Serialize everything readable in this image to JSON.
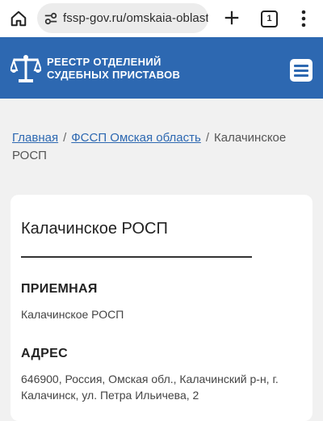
{
  "browser": {
    "url": "fssp-gov.ru/omskaia-oblast/ka",
    "tab_count": "1"
  },
  "header": {
    "title_line1": "РЕЕСТР ОТДЕЛЕНИЙ",
    "title_line2": "СУДЕБНЫХ ПРИСТАВОВ"
  },
  "breadcrumb": {
    "home": "Главная",
    "region": "ФССП Омская область",
    "current": "Калачинское РОСП",
    "separator": "/"
  },
  "card": {
    "title": "Калачинское РОСП",
    "sections": [
      {
        "heading": "ПРИЕМНАЯ",
        "value": "Калачинское РОСП"
      },
      {
        "heading": "АДРЕС",
        "value": "646900, Россия, Омская обл., Калачинский р-н, г. Калачинск, ул. Петра Ильичева, 2"
      }
    ]
  },
  "colors": {
    "header_bg": "#2d68b1",
    "link": "#2d68b1",
    "page_bg": "#f1f1f1"
  },
  "icons": [
    "home-icon",
    "site-settings-icon",
    "plus-icon",
    "tabs-icon",
    "more-vert-icon",
    "scales-logo-icon",
    "hamburger-menu-icon"
  ]
}
